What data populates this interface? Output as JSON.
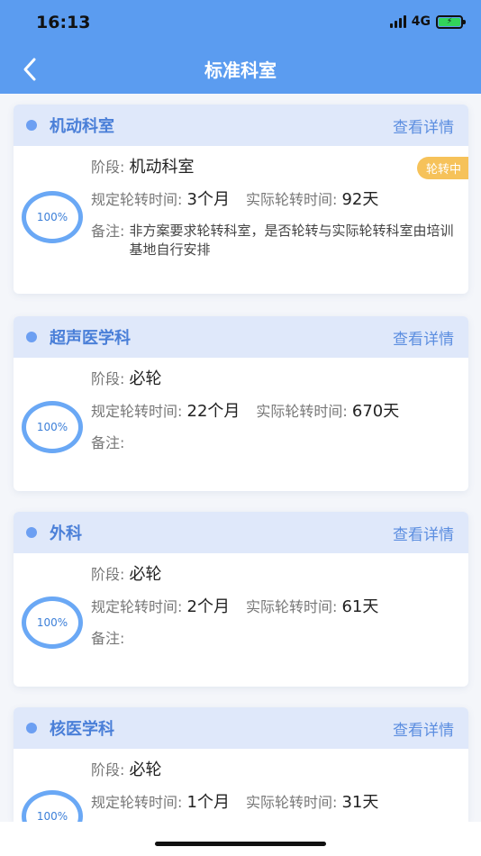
{
  "status": {
    "time": "16:13",
    "network": "4G"
  },
  "header": {
    "title": "标准科室"
  },
  "labels": {
    "detail": "查看详情",
    "stage": "阶段:",
    "planned": "规定轮转时间:",
    "actual": "实际轮转时间:",
    "remark": "备注:"
  },
  "cards": [
    {
      "name": "机动科室",
      "stage": "机动科室",
      "planned": "3个月",
      "actual": "92天",
      "progress": "100%",
      "badge": "轮转中",
      "remark": "非方案要求轮转科室，是否轮转与实际轮转科室由培训基地自行安排"
    },
    {
      "name": "超声医学科",
      "stage": "必轮",
      "planned": "22个月",
      "actual": "670天",
      "progress": "100%",
      "badge": "",
      "remark": ""
    },
    {
      "name": "外科",
      "stage": "必轮",
      "planned": "2个月",
      "actual": "61天",
      "progress": "100%",
      "badge": "",
      "remark": ""
    },
    {
      "name": "核医学科",
      "stage": "必轮",
      "planned": "1个月",
      "actual": "31天",
      "progress": "100%",
      "badge": "",
      "remark": ""
    }
  ],
  "colors": {
    "header": "#5b9cf0",
    "accent": "#4a7fd8",
    "badge": "#f6c25a",
    "ring": "#6aa8f5"
  },
  "icons": {
    "back": "chevron-left-icon",
    "signal": "signal-icon",
    "battery": "battery-charging-icon"
  }
}
